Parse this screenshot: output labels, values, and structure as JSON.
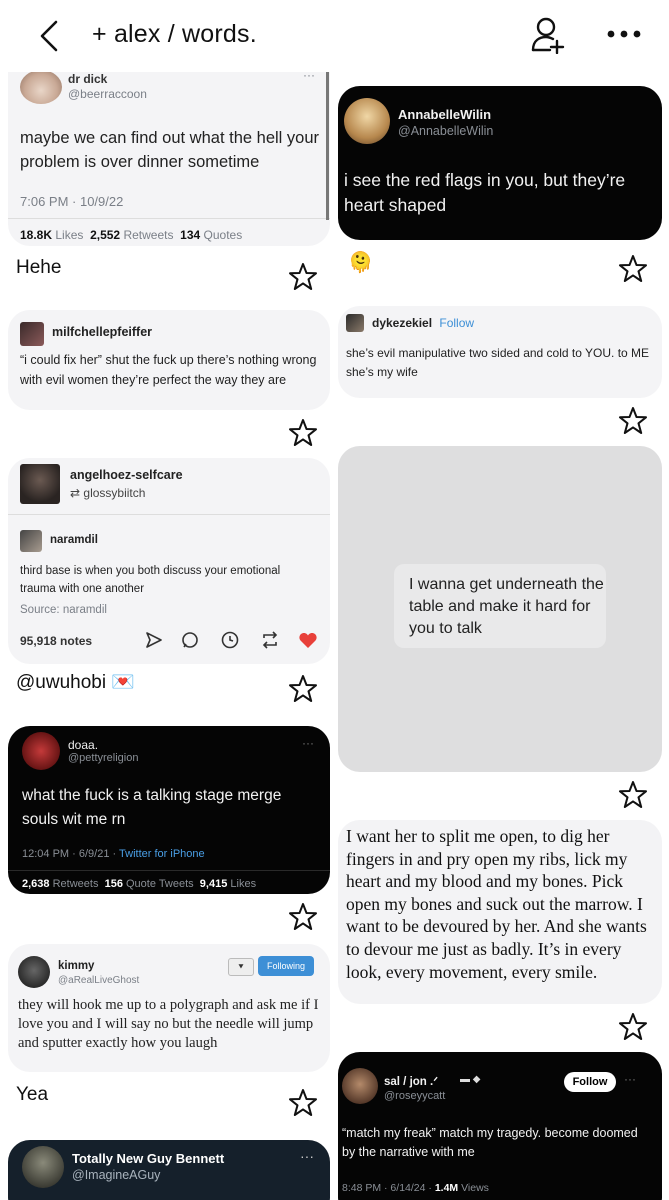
{
  "header": {
    "title": "+ alex / words.",
    "back_icon": "chevron-left-icon",
    "add_user_icon": "add-user-icon",
    "more_icon": "more-dots-icon"
  },
  "pins": {
    "drdick": {
      "name": "dr dick",
      "handle": "@beerraccoon",
      "text": "maybe we can find out what the hell your problem is over dinner sometime",
      "time": "7:06 PM · 10/9/22",
      "likes_num": "18.8K",
      "likes_label": "Likes",
      "retweets_num": "2,552",
      "retweets_label": "Retweets",
      "quotes_num": "134",
      "quotes_label": "Quotes",
      "caption": "Hehe"
    },
    "annabelle": {
      "name": "AnnabelleWilin",
      "handle": "@AnnabelleWilin",
      "text": "i see the red flags in you, but they’re heart shaped",
      "caption_emoji": "🫠"
    },
    "milf": {
      "name": "milfchellepfeiffer",
      "text": "“i could fix her” shut the fuck up there’s nothing wrong with evil women they’re perfect the way they are"
    },
    "dyke": {
      "name": "dykezekiel",
      "follow": "Follow",
      "text": "she’s evil manipulative two sided and cold to YOU. to ME she’s my wife"
    },
    "angel": {
      "name": "angelhoez-selfcare",
      "reblog": "glossybiitch",
      "sub_name": "naramdil",
      "text": "third base is when you both discuss your emotional trauma with one another",
      "source": "Source: naramdil",
      "notes": "95,918 notes",
      "caption": "@uwuhobi 💌"
    },
    "table": {
      "text": "I wanna get underneath the table and make it hard for you to talk"
    },
    "doaa": {
      "name": "doaa.",
      "handle": "@pettyreligion",
      "text": "what the fuck is a talking stage merge souls wit me rn",
      "time": "12:04 PM · 6/9/21 · ",
      "client": "Twitter for iPhone",
      "retweets_num": "2,638",
      "retweets_label": "Retweets",
      "quotes_num": "156",
      "quotes_label": "Quote Tweets",
      "likes_num": "9,415",
      "likes_label": "Likes"
    },
    "devour": {
      "text": "I want her to split me open, to dig her fingers in and pry open my ribs, lick my heart and my blood and my bones. Pick open my bones and suck out the marrow. I want to be devoured by her. And she wants to devour me just as badly. It’s in every look, every movement, every smile."
    },
    "kimmy": {
      "name": "kimmy",
      "handle": "@aRealLiveGhost",
      "following": "Following",
      "text": "they will hook me up to a polygraph and ask me if I love you and I will say no but the needle will jump and sputter exactly how you laugh",
      "caption": "Yea"
    },
    "sal": {
      "name": "sal / jon .ᐟ",
      "handle": "@roseyycatt",
      "follow": "Follow",
      "text": "“match my freak” match my tragedy. become doomed by the narrative with me",
      "time": "8:48 PM · 6/14/24 · ",
      "views_num": "1.4M",
      "views_label": "Views"
    },
    "bennett": {
      "name": "Totally New Guy Bennett",
      "handle": "@ImagineAGuy"
    }
  }
}
